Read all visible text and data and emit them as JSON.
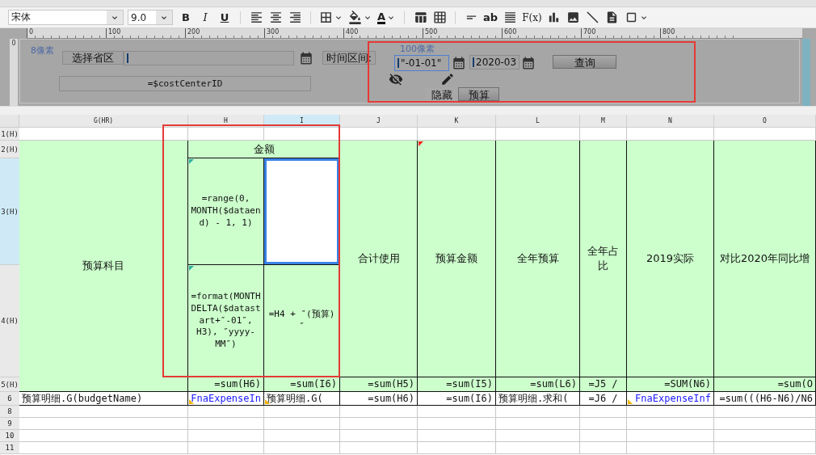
{
  "toolbar": {
    "font": "宋体",
    "size": "9.0",
    "tools": [
      {
        "kind": "bold",
        "label": "B"
      },
      {
        "kind": "italic",
        "label": "I"
      },
      {
        "kind": "underline",
        "label": "U"
      },
      {
        "kind": "sep"
      },
      {
        "kind": "align_left"
      },
      {
        "kind": "align_center"
      },
      {
        "kind": "align_right"
      },
      {
        "kind": "sep"
      },
      {
        "kind": "borders",
        "dropdown": true
      },
      {
        "kind": "fill",
        "dropdown": true
      },
      {
        "kind": "font_color",
        "label": "A",
        "dropdown": true
      },
      {
        "kind": "sep"
      },
      {
        "kind": "merge"
      },
      {
        "kind": "grid"
      },
      {
        "kind": "sep"
      },
      {
        "kind": "field"
      },
      {
        "kind": "text",
        "label": "ab"
      },
      {
        "kind": "paragraph"
      },
      {
        "kind": "formula",
        "label": "F(x)"
      },
      {
        "kind": "chart"
      },
      {
        "kind": "image"
      },
      {
        "kind": "slash"
      },
      {
        "kind": "page"
      },
      {
        "kind": "frame",
        "dropdown": true
      }
    ]
  },
  "ruler": {
    "vertical": "0",
    "marks": [
      "0",
      "100",
      "200",
      "300",
      "400",
      "500",
      "600",
      "700",
      "800"
    ]
  },
  "form": {
    "widgets": [
      {
        "kind": "hint",
        "text": "8像素"
      },
      {
        "kind": "label",
        "text": "选择省区"
      },
      {
        "kind": "input",
        "selected": false
      },
      {
        "kind": "calendar"
      },
      {
        "kind": "field",
        "text": "=$costCenterID"
      },
      {
        "kind": "label",
        "text": "时间区间:"
      },
      {
        "kind": "hint",
        "text": "100像素"
      },
      {
        "kind": "input",
        "value": "\"-01-01\"",
        "selected": true
      },
      {
        "kind": "calendar"
      },
      {
        "kind": "input",
        "value": "2020-03",
        "selected": false
      },
      {
        "kind": "calendar"
      },
      {
        "kind": "button",
        "text": "查询"
      },
      {
        "kind": "eye_off"
      },
      {
        "kind": "pencil"
      },
      {
        "kind": "plain_button",
        "text": "隐藏"
      },
      {
        "kind": "button",
        "text": "预算"
      }
    ]
  },
  "sheet": {
    "columns": [
      {
        "label": "G(HR)",
        "selected": false
      },
      {
        "label": "H",
        "selected": false
      },
      {
        "label": "I",
        "selected": true
      },
      {
        "label": "J",
        "selected": false
      },
      {
        "label": "K",
        "selected": false
      },
      {
        "label": "L",
        "selected": false
      },
      {
        "label": "M",
        "selected": false
      },
      {
        "label": "N",
        "selected": false
      },
      {
        "label": "O",
        "selected": false
      }
    ],
    "rows": [
      {
        "label": "1(H)",
        "selected": false
      },
      {
        "label": "2(H)",
        "selected": false
      },
      {
        "label": "3(H)",
        "selected": true
      },
      {
        "label": "4(H)",
        "selected": false
      },
      {
        "label": "5(H)",
        "selected": false
      },
      {
        "label": "6",
        "selected": false
      },
      {
        "label": "8",
        "selected": false
      },
      {
        "label": "9",
        "selected": false
      },
      {
        "label": "10",
        "selected": false
      },
      {
        "label": "11",
        "selected": false
      }
    ],
    "cells": [
      {
        "kind": "header",
        "text": "预算科目",
        "selected": false
      },
      {
        "kind": "header",
        "text": "金额",
        "selected": false
      },
      {
        "kind": "header",
        "text": "合计使用",
        "selected": false
      },
      {
        "kind": "header",
        "text": "预算金额",
        "color": "#ff2020",
        "selected": false
      },
      {
        "kind": "header",
        "text": "全年预算",
        "selected": false
      },
      {
        "kind": "header",
        "text": "全年占比",
        "selected": false
      },
      {
        "kind": "header",
        "text": "2019实际",
        "selected": false
      },
      {
        "kind": "header",
        "text": "对比2020年同比增",
        "selected": false
      },
      {
        "kind": "formula_head",
        "text": "=range(0, MONTH($dataend) - 1, 1)",
        "color": "#30b0a0",
        "selected": false
      },
      {
        "kind": "blank",
        "selected": true
      },
      {
        "kind": "formula_head",
        "text": "=format(MONTHDELTA($datastart+″-01″, H3), ″yyyy-MM″)",
        "color": "#30b0a0",
        "selected": false
      },
      {
        "kind": "formula_head",
        "text": "=H4 + ″(预算)″",
        "selected": false
      },
      {
        "kind": "total",
        "text": "=sum(H6)",
        "selected": false
      },
      {
        "kind": "total",
        "text": "=sum(I6)",
        "selected": false
      },
      {
        "kind": "total",
        "text": "=sum(H5)",
        "selected": false
      },
      {
        "kind": "total",
        "text": "=sum(I5)",
        "selected": false
      },
      {
        "kind": "total",
        "text": "=sum(L6)",
        "selected": false
      },
      {
        "kind": "total_center",
        "text": "=J5 /",
        "selected": false
      },
      {
        "kind": "total",
        "text": "=SUM(N6)",
        "selected": false
      },
      {
        "kind": "total",
        "text": "=sum(O",
        "selected": false
      },
      {
        "kind": "data",
        "text": "预算明细.G(budgetName)",
        "selected": false
      },
      {
        "kind": "dataset",
        "text": "FnaExpenseIn",
        "color": "#f0b400",
        "selected": false
      },
      {
        "kind": "data",
        "text": "预算明细.G(",
        "color": "#f0b400",
        "selected": false
      },
      {
        "kind": "data_right",
        "text": "=sum(H6)",
        "selected": false
      },
      {
        "kind": "data_right",
        "text": "=sum(I6)",
        "selected": false
      },
      {
        "kind": "data",
        "text": "预算明细.求和(",
        "selected": false
      },
      {
        "kind": "data_center",
        "text": "=J6 /",
        "selected": false
      },
      {
        "kind": "dataset",
        "text": "FnaExpenseInf",
        "color": "#f0b400",
        "selected": false
      },
      {
        "kind": "data_right",
        "text": "=sum(((H6-N6)/N6",
        "selected": false
      }
    ]
  }
}
